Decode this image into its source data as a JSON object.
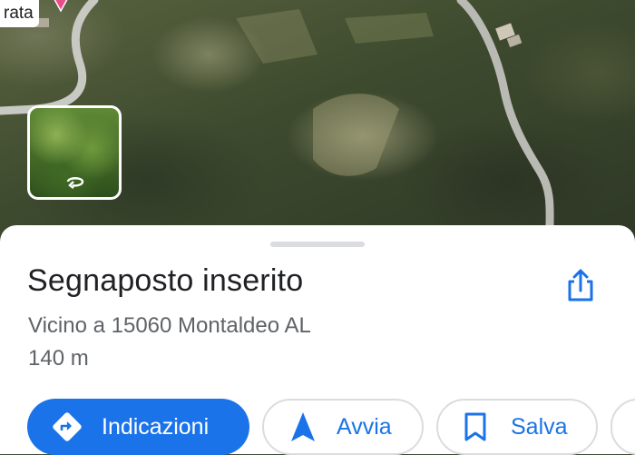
{
  "map": {
    "place_label": "rata",
    "icons": {
      "pin": "map-pin-icon",
      "street_view_rotate": "rotate-360-icon"
    }
  },
  "place_sheet": {
    "title": "Segnaposto inserito",
    "address": "Vicino a 15060 Montaldeo AL",
    "distance": "140 m",
    "share_icon": "share-icon"
  },
  "actions": {
    "directions_label": "Indicazioni",
    "start_label": "Avvia",
    "save_label": "Salva"
  },
  "colors": {
    "accent": "#1a73e8",
    "pin": "#ea4c89",
    "title_text": "#202124",
    "secondary_text": "#5f6368"
  }
}
